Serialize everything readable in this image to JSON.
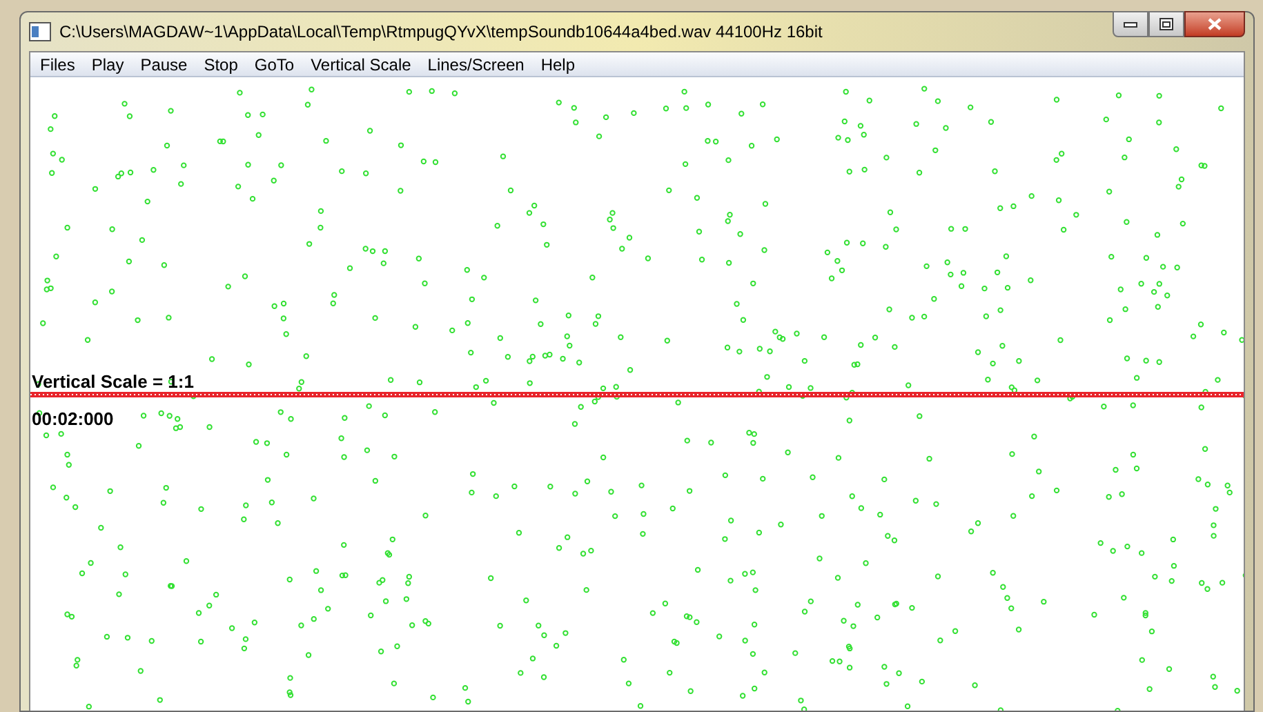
{
  "window": {
    "title": "C:\\Users\\MAGDAW~1\\AppData\\Local\\Temp\\RtmpugQYvX\\tempSoundb10644a4bed.wav 44100Hz 16bit"
  },
  "menu": [
    "Files",
    "Play",
    "Pause",
    "Stop",
    "GoTo",
    "Vertical Scale",
    "Lines/Screen",
    "Help"
  ],
  "canvas": {
    "scale_label": "Vertical Scale = 1:1",
    "time_label": "00:02:000"
  }
}
